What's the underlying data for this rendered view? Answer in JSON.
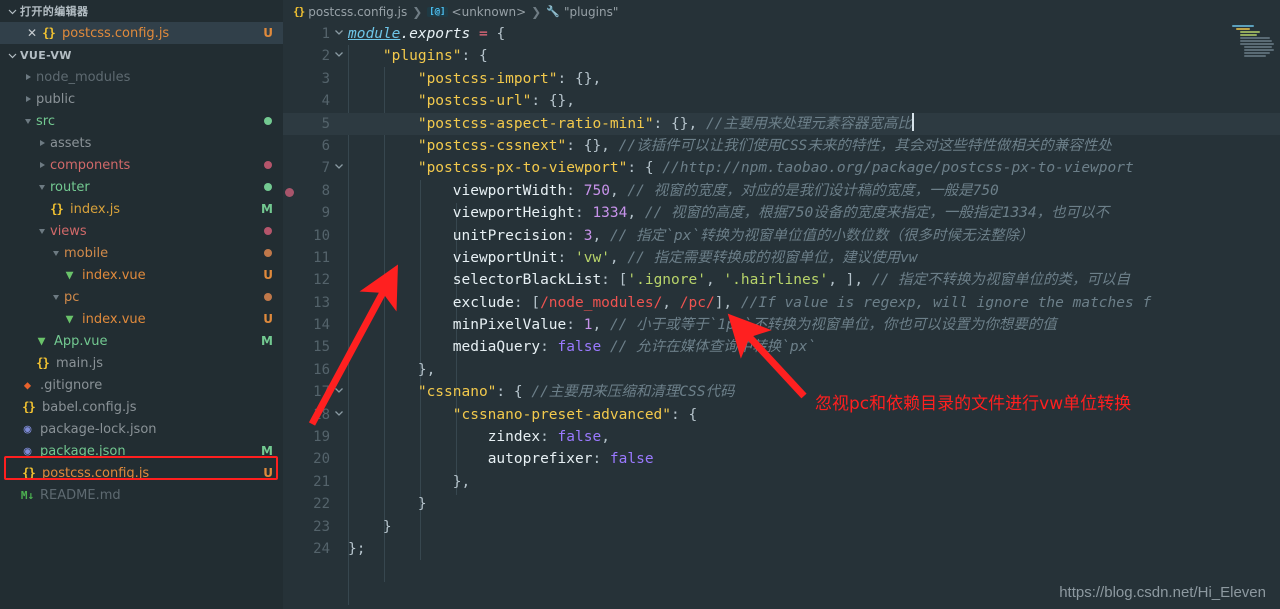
{
  "sidebar": {
    "open_editors_title": "打开的编辑器",
    "open_editors": [
      {
        "name": "postcss.config.js",
        "icon": "js-file-icon",
        "badge": "U",
        "badge_color": "#e08a3c",
        "text_color": "#e08a3c",
        "selected": true
      }
    ],
    "project_title": "VUE-VW",
    "tree": [
      {
        "label": "node_modules",
        "icon": "folder-collapsed-icon",
        "indent": 1,
        "expanded": false,
        "color": "#5e6a71",
        "badge": "",
        "dot": ""
      },
      {
        "label": "public",
        "icon": "folder-collapsed-icon",
        "indent": 1,
        "expanded": false,
        "color": "#8a9297",
        "badge": "",
        "dot": ""
      },
      {
        "label": "src",
        "icon": "folder-expanded-icon",
        "indent": 1,
        "expanded": true,
        "color": "#73c991",
        "badge": "",
        "dot": "#73c991"
      },
      {
        "label": "assets",
        "icon": "folder-collapsed-icon",
        "indent": 2,
        "expanded": false,
        "color": "#8a9297",
        "badge": "",
        "dot": ""
      },
      {
        "label": "components",
        "icon": "folder-collapsed-icon",
        "indent": 2,
        "expanded": false,
        "color": "#d16969",
        "badge": "",
        "dot": "#b5556b"
      },
      {
        "label": "router",
        "icon": "folder-expanded-icon",
        "indent": 2,
        "expanded": true,
        "color": "#73c991",
        "badge": "",
        "dot": "#73c991"
      },
      {
        "label": "index.js",
        "icon": "js-file-icon",
        "indent": 3,
        "file": true,
        "color": "#d7a13b",
        "badge": "M",
        "badge_color": "#73c991",
        "dot": ""
      },
      {
        "label": "views",
        "icon": "folder-expanded-icon",
        "indent": 2,
        "expanded": true,
        "color": "#d16969",
        "badge": "",
        "dot": "#b5556b"
      },
      {
        "label": "mobile",
        "icon": "folder-expanded-icon",
        "indent": 3,
        "expanded": true,
        "color": "#d18a4a",
        "badge": "",
        "dot": "#c0784a"
      },
      {
        "label": "index.vue",
        "icon": "vue-file-icon",
        "indent": 4,
        "file": true,
        "color": "#e08a3c",
        "badge": "U",
        "badge_color": "#e08a3c",
        "dot": ""
      },
      {
        "label": "pc",
        "icon": "folder-expanded-icon",
        "indent": 3,
        "expanded": true,
        "color": "#d18a4a",
        "badge": "",
        "dot": "#c0784a"
      },
      {
        "label": "index.vue",
        "icon": "vue-file-icon",
        "indent": 4,
        "file": true,
        "color": "#e08a3c",
        "badge": "U",
        "badge_color": "#e08a3c",
        "dot": ""
      },
      {
        "label": "App.vue",
        "icon": "vue-file-icon",
        "indent": 2,
        "file": true,
        "color": "#73c991",
        "badge": "M",
        "badge_color": "#73c991",
        "dot": ""
      },
      {
        "label": "main.js",
        "icon": "js-file-icon",
        "indent": 2,
        "file": true,
        "color": "#8a9297",
        "badge": "",
        "dot": ""
      },
      {
        "label": ".gitignore",
        "icon": "git-file-icon",
        "indent": 1,
        "file": true,
        "color": "#8a9297",
        "badge": "",
        "dot": ""
      },
      {
        "label": "babel.config.js",
        "icon": "js-file-icon",
        "indent": 1,
        "file": true,
        "color": "#8a9297",
        "badge": "",
        "dot": ""
      },
      {
        "label": "package-lock.json",
        "icon": "json-file-icon",
        "indent": 1,
        "file": true,
        "color": "#8a9297",
        "badge": "",
        "dot": ""
      },
      {
        "label": "package.json",
        "icon": "json-file-icon",
        "indent": 1,
        "file": true,
        "color": "#73c991",
        "badge": "M",
        "badge_color": "#73c991",
        "dot": ""
      },
      {
        "label": "postcss.config.js",
        "icon": "js-file-icon",
        "indent": 1,
        "file": true,
        "color": "#e08a3c",
        "badge": "U",
        "badge_color": "#e08a3c",
        "dot": "",
        "highlighted": true
      },
      {
        "label": "README.md",
        "icon": "md-file-icon",
        "indent": 1,
        "file": true,
        "color": "#5e6a71",
        "badge": "",
        "dot": ""
      }
    ]
  },
  "breadcrumb": {
    "file": "postcss.config.js",
    "symbol_unknown": "<unknown>",
    "symbol_plugins": "\"plugins\"",
    "separator": "›"
  },
  "editor": {
    "lines": [
      {
        "n": 1,
        "fold": "down",
        "bp": false,
        "active": false
      },
      {
        "n": 2,
        "fold": "down",
        "bp": false,
        "active": false
      },
      {
        "n": 3,
        "fold": "",
        "bp": false,
        "active": false
      },
      {
        "n": 4,
        "fold": "",
        "bp": false,
        "active": false
      },
      {
        "n": 5,
        "fold": "",
        "bp": false,
        "active": true
      },
      {
        "n": 6,
        "fold": "",
        "bp": false,
        "active": false
      },
      {
        "n": 7,
        "fold": "down",
        "bp": false,
        "active": false
      },
      {
        "n": 8,
        "fold": "",
        "bp": true,
        "active": false
      },
      {
        "n": 9,
        "fold": "",
        "bp": false,
        "active": false
      },
      {
        "n": 10,
        "fold": "",
        "bp": false,
        "active": false
      },
      {
        "n": 11,
        "fold": "",
        "bp": false,
        "active": false
      },
      {
        "n": 12,
        "fold": "",
        "bp": false,
        "active": false
      },
      {
        "n": 13,
        "fold": "",
        "bp": false,
        "active": false
      },
      {
        "n": 14,
        "fold": "",
        "bp": false,
        "active": false
      },
      {
        "n": 15,
        "fold": "",
        "bp": false,
        "active": false
      },
      {
        "n": 16,
        "fold": "",
        "bp": false,
        "active": false
      },
      {
        "n": 17,
        "fold": "down",
        "bp": false,
        "active": false
      },
      {
        "n": 18,
        "fold": "down",
        "bp": false,
        "active": false
      },
      {
        "n": 19,
        "fold": "",
        "bp": false,
        "active": false
      },
      {
        "n": 20,
        "fold": "",
        "bp": false,
        "active": false
      },
      {
        "n": 21,
        "fold": "",
        "bp": false,
        "active": false
      },
      {
        "n": 22,
        "fold": "",
        "bp": false,
        "active": false
      },
      {
        "n": 23,
        "fold": "",
        "bp": false,
        "active": false
      },
      {
        "n": 24,
        "fold": "",
        "bp": false,
        "active": false
      }
    ],
    "code_text": {
      "l1": "module.exports = {",
      "l2": "    \"plugins\": {",
      "l3": "        \"postcss-import\": {},",
      "l4": "        \"postcss-url\": {},",
      "l5": "        \"postcss-aspect-ratio-mini\": {}, //主要用来处理元素容器宽高比",
      "l6": "        \"postcss-cssnext\": {}, //该插件可以让我们使用CSS未来的特性，其会对这些特性做相关的兼容性处",
      "l7": "        \"postcss-px-to-viewport\": { //http://npm.taobao.org/package/postcss-px-to-viewport",
      "l8": "            viewportWidth: 750, // 视窗的宽度，对应的是我们设计稿的宽度，一般是750",
      "l9": "            viewportHeight: 1334, // 视窗的高度，根据750设备的宽度来指定，一般指定1334，也可以不",
      "l10": "            unitPrecision: 3, // 指定`px`转换为视窗单位值的小数位数（很多时候无法整除）",
      "l11": "            viewportUnit: 'vw', // 指定需要转换成的视窗单位，建议使用vw",
      "l12": "            selectorBlackList: ['.ignore', '.hairlines', ], // 指定不转换为视窗单位的类，可以自",
      "l13": "            exclude: [/node_modules/, /pc/], //If value is regexp, will ignore the matches f",
      "l14": "            minPixelValue: 1, // 小于或等于`1px`不转换为视窗单位，你也可以设置为你想要的值",
      "l15": "            mediaQuery: false // 允许在媒体查询中转换`px`",
      "l16": "        },",
      "l17": "        \"cssnano\": { //主要用来压缩和清理CSS代码",
      "l18": "            \"cssnano-preset-advanced\": {",
      "l19": "                zindex: false,",
      "l20": "                autoprefixer: false",
      "l21": "            },",
      "l22": "        }",
      "l23": "    }",
      "l24": "};"
    }
  },
  "annotations": {
    "note_text": "忽视pc和依赖目录的文件进行vw单位转换",
    "note_color": "#ff1f1f",
    "arrow_color": "#ff2020",
    "highlight_box_color": "#ff1f1f"
  },
  "watermark": "https://blog.csdn.net/Hi_Eleven",
  "theme": {
    "sidebar_bg": "#222d32",
    "editor_bg": "#263238",
    "selected_row_bg": "#31404a",
    "active_line_bg": "#2d3a41",
    "line_number": "#54636b",
    "comment": "#6c7f89",
    "string": "#b8d46a",
    "key": "#f2c94c",
    "number": "#c792ea",
    "boolean": "#9a79ff"
  }
}
